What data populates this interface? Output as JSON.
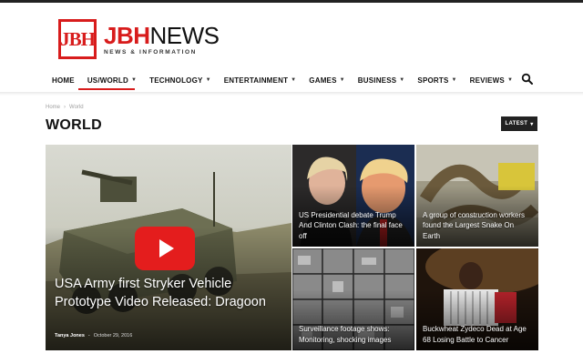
{
  "logo": {
    "mark": "JBH",
    "brand_red": "JBH",
    "brand_dark": "NEWS",
    "tagline": "NEWS & INFORMATION"
  },
  "nav": {
    "items": [
      {
        "label": "HOME",
        "has_dropdown": false,
        "active": false
      },
      {
        "label": "US/WORLD",
        "has_dropdown": true,
        "active": true
      },
      {
        "label": "TECHNOLOGY",
        "has_dropdown": true,
        "active": false
      },
      {
        "label": "ENTERTAINMENT",
        "has_dropdown": true,
        "active": false
      },
      {
        "label": "GAMES",
        "has_dropdown": true,
        "active": false
      },
      {
        "label": "BUSINESS",
        "has_dropdown": true,
        "active": false
      },
      {
        "label": "SPORTS",
        "has_dropdown": true,
        "active": false
      },
      {
        "label": "REVIEWS",
        "has_dropdown": true,
        "active": false
      }
    ],
    "search_icon": "search-icon"
  },
  "breadcrumb": {
    "home": "Home",
    "separator": "›",
    "current": "World"
  },
  "page": {
    "title": "WORLD",
    "sort_label": "LATEST",
    "sort_chevron": "▾"
  },
  "featured": {
    "title": "USA Army first Stryker Vehicle Prototype Video Released: Dragoon",
    "author": "Tanya Jones",
    "separator": "-",
    "date": "October 29, 2016",
    "has_video": true
  },
  "side_stories": [
    {
      "title": "US Presidential debate Trump And Clinton Clash: the final face off"
    },
    {
      "title": "A group of construction workers found the Largest Snake On Earth"
    },
    {
      "title": "Surveillance footage shows: Monitoring, shocking images"
    },
    {
      "title": "Buckwheat Zydeco Dead at Age 68 Losing Battle to Cancer"
    }
  ],
  "colors": {
    "accent": "#d81c1c",
    "dark": "#222222",
    "play_button": "#e41d1d"
  }
}
